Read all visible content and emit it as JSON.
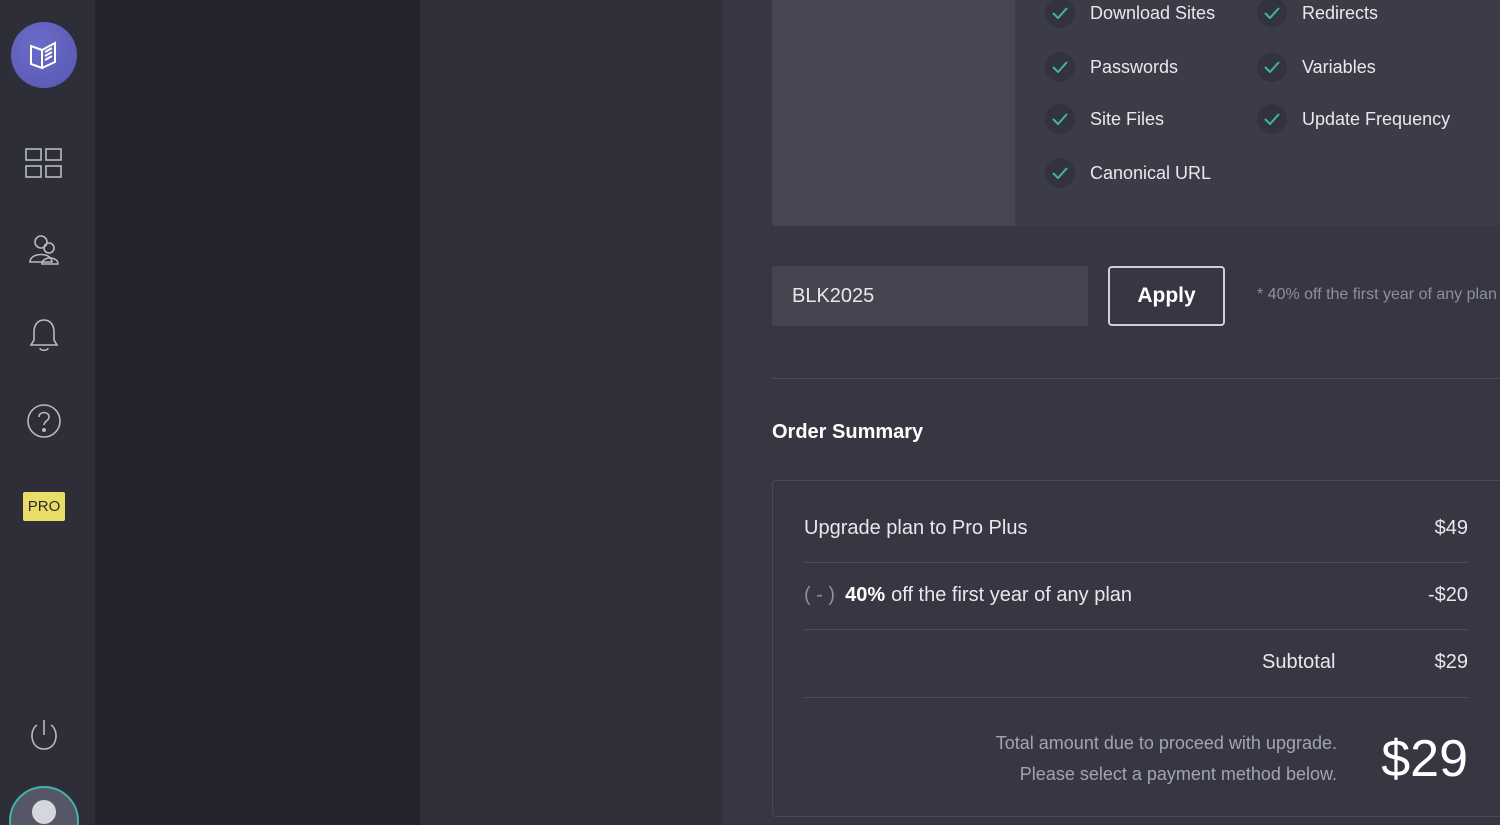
{
  "rail": {
    "logo_icon": "book-logo-icon",
    "items": [
      {
        "name": "dashboard",
        "icon": "grid-icon"
      },
      {
        "name": "users",
        "icon": "users-icon"
      },
      {
        "name": "notifications",
        "icon": "bell-icon"
      },
      {
        "name": "help",
        "icon": "question-icon"
      }
    ],
    "pro_badge": "PRO",
    "power_icon": "power-icon",
    "avatar_icon": "avatar-icon"
  },
  "features": [
    {
      "label": "Download Sites"
    },
    {
      "label": "Redirects"
    },
    {
      "label": "Passwords"
    },
    {
      "label": "Variables"
    },
    {
      "label": "Site Files"
    },
    {
      "label": "Update Frequency"
    },
    {
      "label": "Canonical URL"
    }
  ],
  "coupon": {
    "value": "BLK2025",
    "apply_label": "Apply",
    "note": "* 40% off the first year of any plan"
  },
  "order": {
    "title": "Order Summary",
    "upgrade_label": "Upgrade plan to Pro Plus",
    "upgrade_price": "$49",
    "discount_paren": "( - )",
    "discount_bold": "40%",
    "discount_text": "off the first year of any plan",
    "discount_price": "-$20",
    "subtotal_label": "Subtotal",
    "subtotal_value": "$29",
    "total_line1": "Total amount due to proceed with upgrade.",
    "total_line2": "Please select a payment method below.",
    "total_value": "$29"
  },
  "colors": {
    "accent_check": "#3fb5a3",
    "pro_badge": "#e9dc67",
    "logo": "#5f61c0"
  }
}
